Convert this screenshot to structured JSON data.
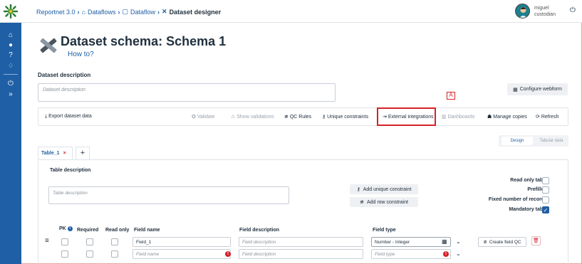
{
  "topbar": {
    "crumbs": [
      "Reportnet 3.0",
      "Dataflows",
      "Dataflow",
      "Dataset designer"
    ],
    "user_first": "miguel",
    "user_last": "custodian"
  },
  "page": {
    "title": "Dataset schema: Schema 1",
    "howto": "How to?",
    "dataset_desc_label": "Dataset description",
    "dataset_desc_placeholder": "Dataset description",
    "annotation": "A",
    "configure_webform": "Configure webform"
  },
  "toolbar": {
    "export": "Export dataset data",
    "validate": "Validate",
    "show_validations": "Show validations",
    "qc_rules": "QC Rules",
    "unique_constraints": "Unique constraints",
    "external_integrations": "External integrations",
    "dashboards": "Dashboards",
    "manage_copies": "Manage copies",
    "refresh": "Refresh"
  },
  "view_toggle": {
    "design": "Design",
    "tabular": "Tabular data"
  },
  "tabs": [
    {
      "label": "Table_1"
    }
  ],
  "table": {
    "desc_label": "Table description",
    "desc_placeholder": "Table description",
    "add_unique": "Add unique constraint",
    "add_row": "Add row constraint",
    "read_only_table": "Read only table",
    "prefilled": "Prefilled",
    "fixed_records": "Fixed number of records",
    "mandatory_table": "Mandatory table",
    "mandatory_checked": true
  },
  "fields": {
    "headers": {
      "pk": "PK",
      "required": "Required",
      "read_only": "Read only",
      "name": "Field name",
      "desc": "Field description",
      "type": "Field type"
    },
    "rows": [
      {
        "name": "Field_1",
        "desc_placeholder": "Field description",
        "type": "Number - Integer",
        "create_qc": "Create field QC"
      },
      {
        "name_placeholder": "Field name",
        "desc_placeholder": "Field description",
        "type_placeholder": "Field type"
      }
    ]
  },
  "colors": {
    "primary": "#1f5fa5",
    "danger": "#d4222a"
  }
}
